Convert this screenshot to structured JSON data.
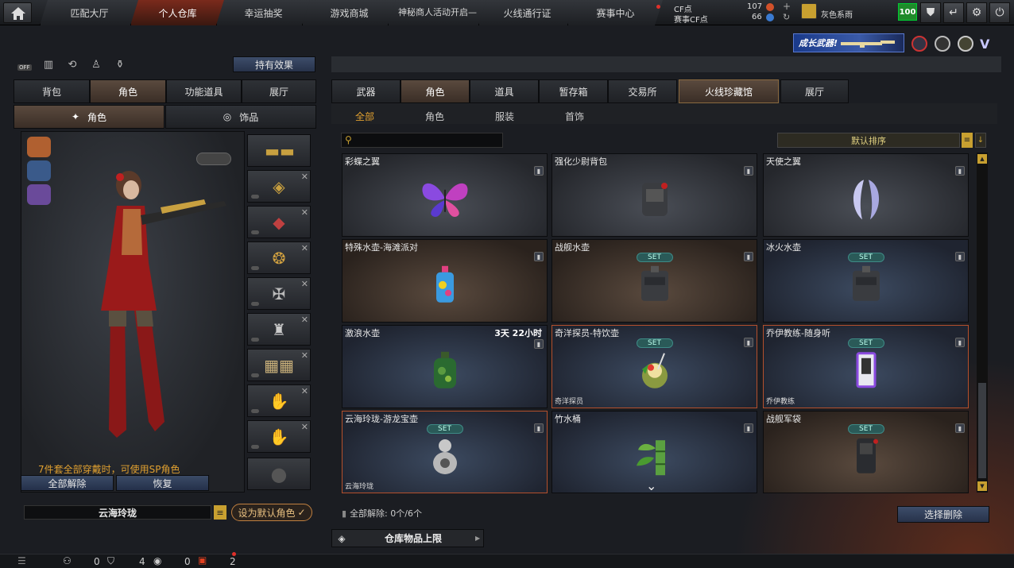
{
  "top_nav": {
    "tabs": [
      "匹配大厅",
      "个人仓库",
      "幸运抽奖",
      "游戏商城",
      "神秘商人活动开启—",
      "火线通行证",
      "赛事中心"
    ],
    "cf_label": "CF点",
    "cf_value": "107",
    "event_cf_label": "赛事CF点",
    "event_cf_value": "66",
    "username": "灰色系雨",
    "level": "100"
  },
  "banner": {
    "text": "成长武器!"
  },
  "left": {
    "effects_button": "持有效果",
    "toggle_off": "OFF",
    "tabs": [
      "背包",
      "角色",
      "功能道具",
      "展厅"
    ],
    "subtabs": [
      "角色",
      "饰品"
    ],
    "hint": "7件套全部穿戴时，可使用SP角色",
    "unequip_all": "全部解除",
    "restore": "恢复",
    "character_name": "云海玲珑",
    "set_default": "设为默认角色"
  },
  "right": {
    "tabs": [
      "武器",
      "角色",
      "道具",
      "暂存箱",
      "交易所",
      "火线珍藏馆",
      "展厅"
    ],
    "subtabs": [
      "全部",
      "角色",
      "服装",
      "首饰"
    ],
    "search_placeholder": "",
    "sort_label": "默认排序",
    "set_badge": "SET",
    "items": [
      {
        "name": "彩蝶之翼",
        "style": "plain",
        "set": false,
        "timer": "",
        "bottom": "",
        "icon": "butterfly-icon"
      },
      {
        "name": "强化少尉背包",
        "style": "plain",
        "set": false,
        "timer": "",
        "bottom": "",
        "icon": "backpack-icon"
      },
      {
        "name": "天使之翼",
        "style": "plain",
        "set": false,
        "timer": "",
        "bottom": "",
        "icon": "wings-icon"
      },
      {
        "name": "特殊水壶-海滩派对",
        "style": "warm",
        "set": false,
        "timer": "",
        "bottom": "",
        "icon": "bottle-icon"
      },
      {
        "name": "战舰水壶",
        "style": "warm",
        "set": true,
        "timer": "",
        "bottom": "",
        "icon": "canteen-icon"
      },
      {
        "name": "冰火水壶",
        "style": "blue",
        "set": true,
        "timer": "",
        "bottom": "",
        "icon": "canteen-icon"
      },
      {
        "name": "激浪水壶",
        "style": "blue",
        "set": false,
        "timer": "3天 22小时",
        "bottom": "",
        "icon": "flask-icon"
      },
      {
        "name": "奇洋探员-特饮壶",
        "style": "blue",
        "set": true,
        "timer": "",
        "bottom": "奇洋探员",
        "icon": "coconut-icon"
      },
      {
        "name": "乔伊教练-随身听",
        "style": "blue",
        "set": true,
        "timer": "",
        "bottom": "乔伊教练",
        "icon": "player-icon"
      },
      {
        "name": "云海玲珑-游龙宝壶",
        "style": "blue",
        "set": true,
        "timer": "",
        "bottom": "云海玲珑",
        "icon": "gourd-icon"
      },
      {
        "name": "竹水桶",
        "style": "blue",
        "set": false,
        "timer": "",
        "bottom": "",
        "icon": "bamboo-icon"
      },
      {
        "name": "战舰军袋",
        "style": "warm",
        "set": true,
        "timer": "",
        "bottom": "",
        "icon": "bag-icon"
      }
    ],
    "unequip_count": "全部解除: 0个/6个",
    "select_delete": "选择删除",
    "warehouse_limit": "仓库物品上限"
  },
  "statusbar": {
    "counts": [
      "0",
      "4",
      "0",
      "2"
    ]
  },
  "colors": {
    "accent": "#b5502c",
    "gold": "#e0a030",
    "set_teal": "#3e8a86"
  }
}
